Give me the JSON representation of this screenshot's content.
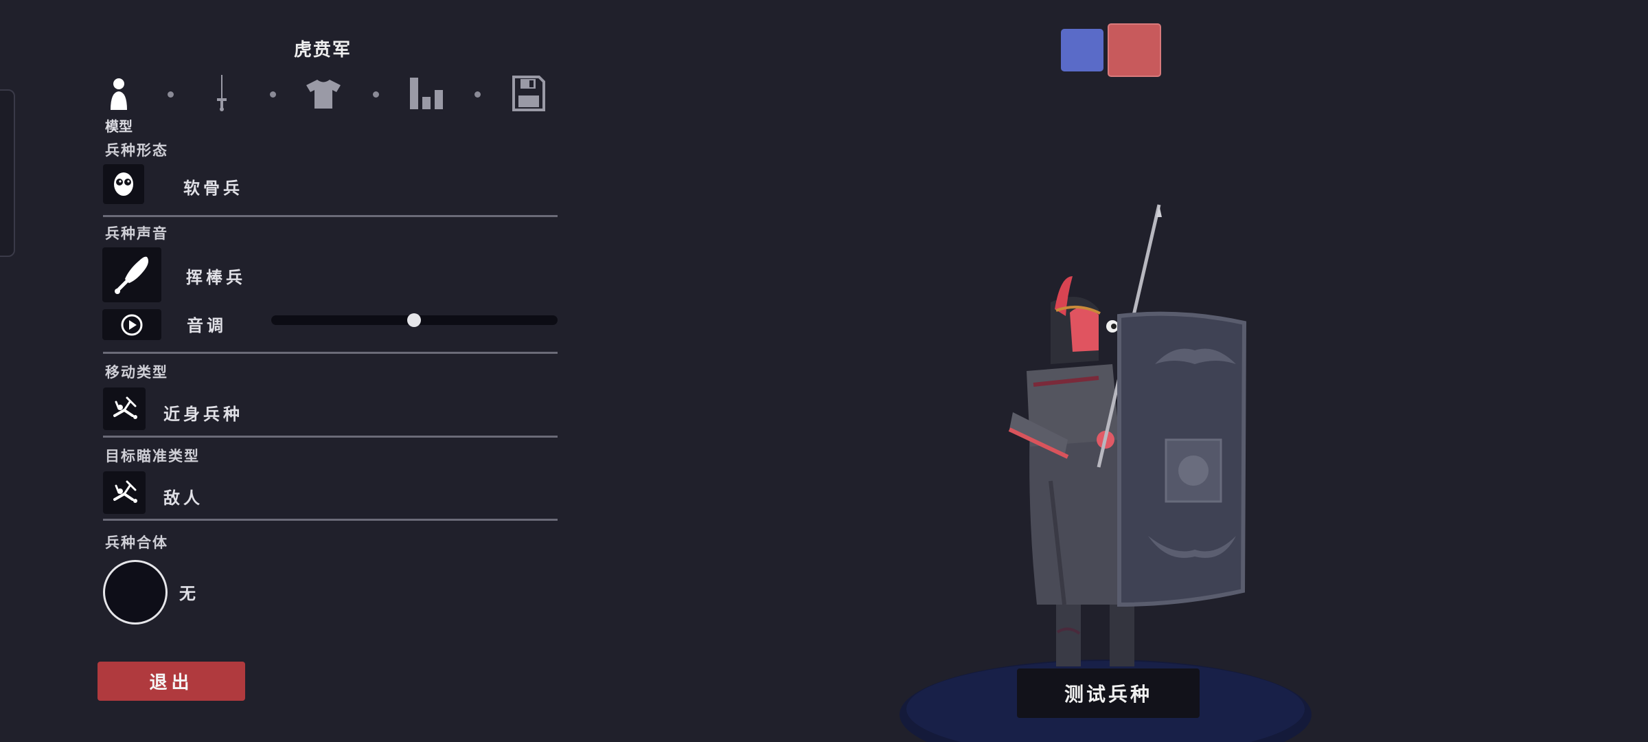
{
  "unit_title": "虎贲军",
  "tabs": {
    "icons": [
      "person-icon",
      "sword-icon",
      "shirt-icon",
      "stats-icon",
      "save-icon"
    ],
    "active_label": "模型"
  },
  "sections": {
    "form": {
      "label": "兵种形态",
      "value": "软骨兵",
      "icon": "ragdoll-face-icon"
    },
    "voice": {
      "label": "兵种声音",
      "value": "挥棒兵",
      "icon": "club-icon",
      "pitch_label": "音调",
      "pitch_value": 0.5,
      "play_icon": "play-icon"
    },
    "movement": {
      "label": "移动类型",
      "value": "近身兵种",
      "icon": "melee-unit-icon"
    },
    "targeting": {
      "label": "目标瞄准类型",
      "value": "敌人",
      "icon": "melee-unit-icon"
    },
    "combine": {
      "label": "兵种合体",
      "value": "无"
    }
  },
  "buttons": {
    "exit": "退出",
    "test_unit": "测试兵种"
  },
  "teams": {
    "blue": "#5a6bc8",
    "red": "#c85a5c",
    "selected": "red"
  },
  "colors": {
    "background": "#20202b",
    "exit_button": "#b03a3e"
  }
}
